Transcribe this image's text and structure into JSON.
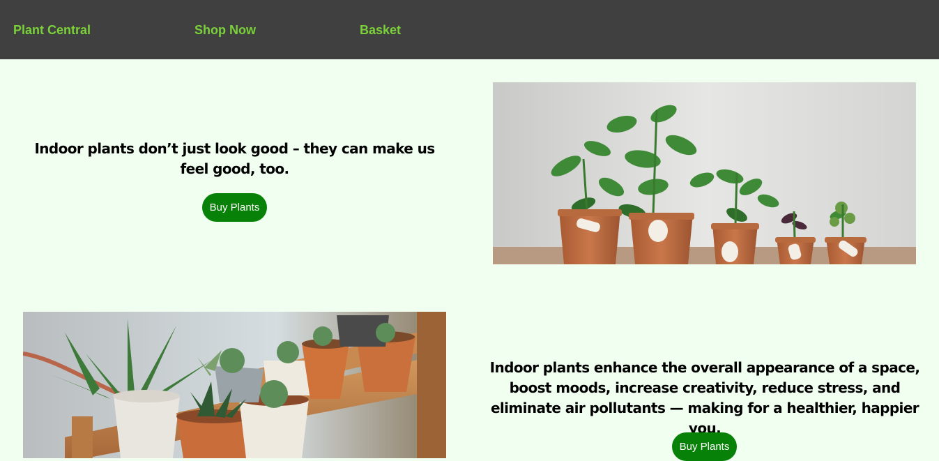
{
  "nav": {
    "brand": "Plant Central",
    "shop": "Shop Now",
    "basket": "Basket"
  },
  "sections": [
    {
      "headline": "Indoor plants don’t just look good – they can make us feel good, too.",
      "button": "Buy Plants"
    },
    {
      "headline": "Indoor plants enhance the overall appearance of a space, boost moods, increase creativity, reduce stress, and eliminate air pollutants — making for a healthier, happier you.",
      "button": "Buy Plants"
    }
  ],
  "colors": {
    "nav_background": "#404040",
    "nav_link": "#7ad13a",
    "page_background": "#f0fff0",
    "button": "#078107"
  }
}
